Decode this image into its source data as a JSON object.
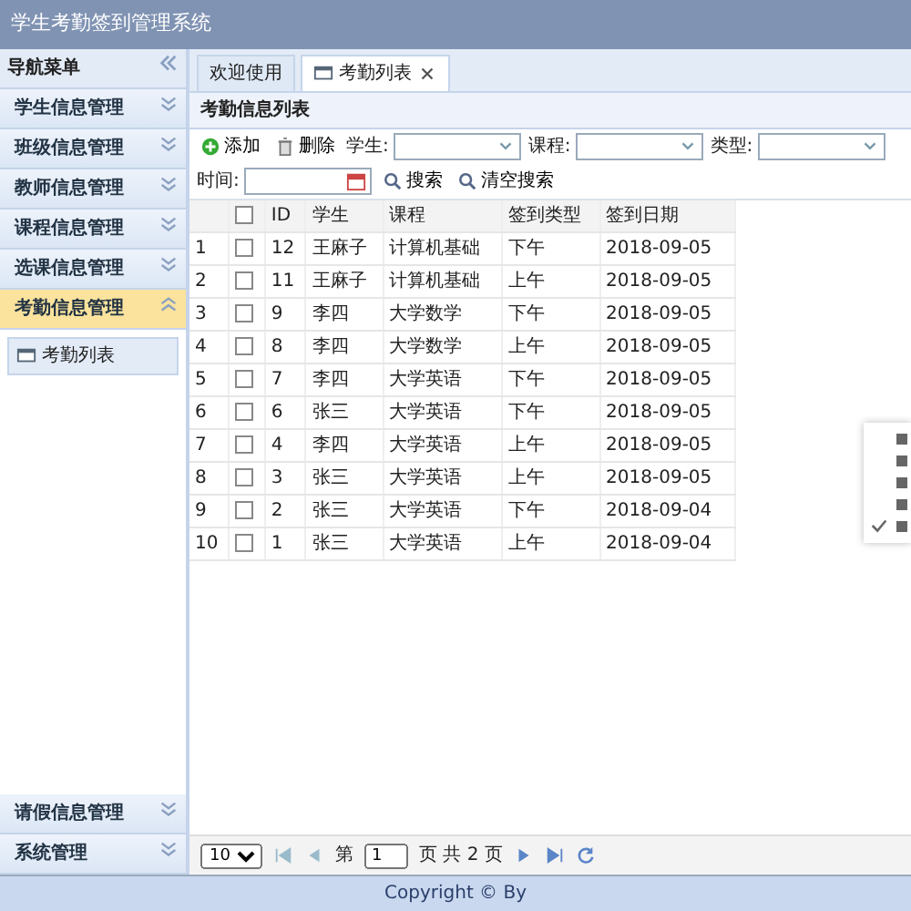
{
  "app_title": "学生考勤签到管理系统",
  "sidebar": {
    "title": "导航菜单",
    "sections": [
      {
        "label": "学生信息管理",
        "expanded": false
      },
      {
        "label": "班级信息管理",
        "expanded": false
      },
      {
        "label": "教师信息管理",
        "expanded": false
      },
      {
        "label": "课程信息管理",
        "expanded": false
      },
      {
        "label": "选课信息管理",
        "expanded": false
      },
      {
        "label": "考勤信息管理",
        "expanded": true,
        "children": [
          {
            "label": "考勤列表"
          }
        ]
      },
      {
        "label": "请假信息管理",
        "expanded": false
      },
      {
        "label": "系统管理",
        "expanded": false
      }
    ]
  },
  "tabs": [
    {
      "label": "欢迎使用",
      "selected": false,
      "closable": false
    },
    {
      "label": "考勤列表",
      "selected": true,
      "closable": true
    }
  ],
  "panel_title": "考勤信息列表",
  "toolbar": {
    "buttons": [
      {
        "label": "添加",
        "kind": "add"
      },
      {
        "label": "删除",
        "kind": "delete"
      }
    ],
    "filters": [
      {
        "label": "学生:",
        "kind": "combo"
      },
      {
        "label": "课程:",
        "kind": "combo"
      },
      {
        "label": "类型:",
        "kind": "combo"
      },
      {
        "label": "时间:",
        "kind": "date"
      }
    ],
    "actions": [
      {
        "label": "搜索"
      },
      {
        "label": "清空搜索"
      }
    ]
  },
  "table": {
    "select_all_checked": false,
    "columns": [
      "ID",
      "学生",
      "课程",
      "签到类型",
      "签到日期"
    ],
    "rows": [
      {
        "row_number": "1",
        "checked": false,
        "cells": [
          "12",
          "王麻子",
          "计算机基础",
          "下午",
          "2018-09-05"
        ]
      },
      {
        "row_number": "2",
        "checked": false,
        "cells": [
          "11",
          "王麻子",
          "计算机基础",
          "上午",
          "2018-09-05"
        ]
      },
      {
        "row_number": "3",
        "checked": false,
        "cells": [
          "9",
          "李四",
          "大学数学",
          "下午",
          "2018-09-05"
        ]
      },
      {
        "row_number": "4",
        "checked": false,
        "cells": [
          "8",
          "李四",
          "大学数学",
          "上午",
          "2018-09-05"
        ]
      },
      {
        "row_number": "5",
        "checked": false,
        "cells": [
          "7",
          "李四",
          "大学英语",
          "下午",
          "2018-09-05"
        ]
      },
      {
        "row_number": "6",
        "checked": false,
        "cells": [
          "6",
          "张三",
          "大学英语",
          "下午",
          "2018-09-05"
        ]
      },
      {
        "row_number": "7",
        "checked": false,
        "cells": [
          "4",
          "李四",
          "大学英语",
          "上午",
          "2018-09-05"
        ]
      },
      {
        "row_number": "8",
        "checked": false,
        "cells": [
          "3",
          "张三",
          "大学英语",
          "上午",
          "2018-09-05"
        ]
      },
      {
        "row_number": "9",
        "checked": false,
        "cells": [
          "2",
          "张三",
          "大学英语",
          "下午",
          "2018-09-04"
        ]
      },
      {
        "row_number": "10",
        "checked": false,
        "cells": [
          "1",
          "张三",
          "大学英语",
          "上午",
          "2018-09-04"
        ]
      }
    ]
  },
  "pager": {
    "page_size": "10",
    "page_prefix": "第",
    "page": "1",
    "page_suffix": "页 共 2 页"
  },
  "footer": "Copyright © By",
  "context_menu": {
    "items": [
      {
        "checked": false
      },
      {
        "checked": false
      },
      {
        "checked": false
      },
      {
        "checked": false
      },
      {
        "checked": true
      }
    ]
  }
}
